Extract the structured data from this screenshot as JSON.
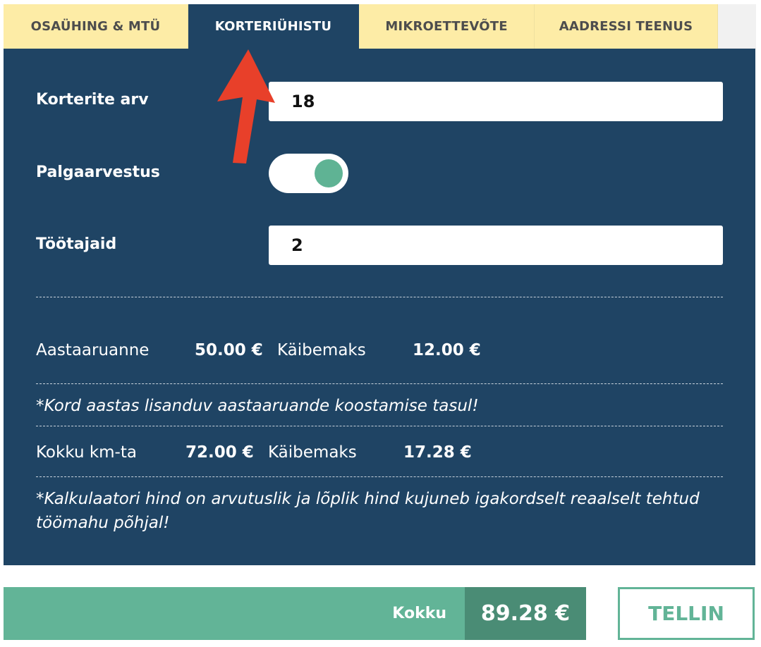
{
  "tabs": [
    {
      "label": "OSAÜHING & MTÜ",
      "active": false
    },
    {
      "label": "KORTERIÜHISTU",
      "active": true
    },
    {
      "label": "MIKROETTEVÕTE",
      "active": false
    },
    {
      "label": "AADRESSI TEENUS",
      "active": false
    }
  ],
  "form": {
    "apartments_label": "Korterite arv",
    "apartments_value": "18",
    "payroll_label": "Palgaarvestus",
    "payroll_enabled": true,
    "employees_label": "Töötajaid",
    "employees_value": "2"
  },
  "summary": {
    "annual_report_label": "Aastaaruanne",
    "annual_report_value": "50.00 €",
    "annual_vat_label": "Käibemaks",
    "annual_vat_value": "12.00 €",
    "annual_note": "*Kord aastas lisanduv aastaaruande koostamise tasul!",
    "total_ex_vat_label": "Kokku km-ta",
    "total_ex_vat_value": "72.00 €",
    "total_vat_label": "Käibemaks",
    "total_vat_value": "17.28 €",
    "disclaimer": "*Kalkulaatori hind on arvutuslik ja lõplik hind kujuneb igakordselt reaalselt tehtud töömahu põhjal!"
  },
  "footer": {
    "total_label": "Kokku",
    "total_value": "89.28 €",
    "order_button": "TELLIN"
  },
  "colors": {
    "panel": "#1f4464",
    "tab_inactive": "#fdeca6",
    "accent_green": "#62b497",
    "accent_green_dark": "#4a8c75",
    "arrow": "#e8402a"
  },
  "icons": {
    "annotation": "red-arrow-up-icon"
  }
}
